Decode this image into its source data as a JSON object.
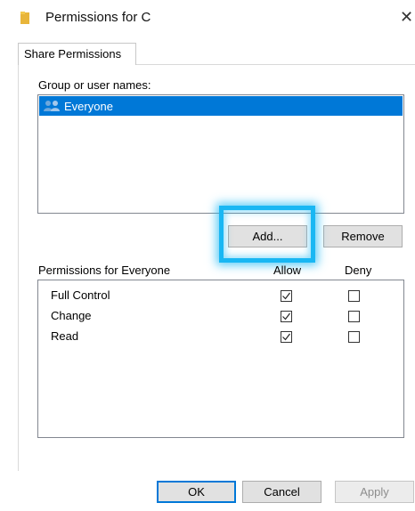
{
  "window": {
    "title": "Permissions for C",
    "close_glyph": "✕"
  },
  "tabs": [
    {
      "label": "Share Permissions",
      "selected": true
    }
  ],
  "group_section": {
    "label": "Group or user names:",
    "items": [
      {
        "name": "Everyone",
        "icon": "users-icon",
        "selected": true
      }
    ]
  },
  "buttons": {
    "add": "Add...",
    "remove": "Remove"
  },
  "permissions": {
    "label": "Permissions for Everyone",
    "allow_header": "Allow",
    "deny_header": "Deny",
    "rows": [
      {
        "name": "Full Control",
        "allow": true,
        "deny": false
      },
      {
        "name": "Change",
        "allow": true,
        "deny": false
      },
      {
        "name": "Read",
        "allow": true,
        "deny": false
      }
    ]
  },
  "footer": {
    "ok": "OK",
    "cancel": "Cancel",
    "apply": "Apply"
  },
  "colors": {
    "selection": "#0078d7",
    "highlight": "#19b7f3"
  }
}
